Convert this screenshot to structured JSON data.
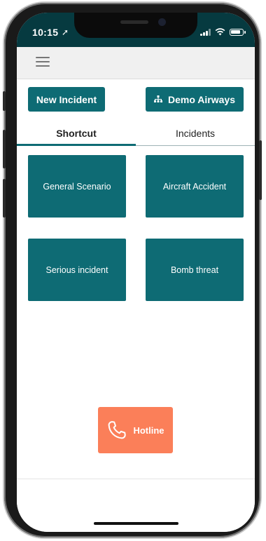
{
  "status_bar": {
    "time": "10:15"
  },
  "header": {
    "menu_icon": "hamburger-icon"
  },
  "actions": {
    "new_incident": "New Incident",
    "organization": "Demo Airways",
    "organization_icon": "org-chart-icon"
  },
  "tabs": [
    {
      "label": "Shortcut",
      "active": true
    },
    {
      "label": "Incidents",
      "active": false
    }
  ],
  "shortcuts": [
    {
      "label": "General Scenario"
    },
    {
      "label": "Aircraft Accident"
    },
    {
      "label": "Serious incident"
    },
    {
      "label": "Bomb threat"
    }
  ],
  "hotline": {
    "label": "Hotline",
    "icon": "phone-icon"
  },
  "colors": {
    "primary": "#0e6b74",
    "status_bar": "#063a40",
    "hotline": "#fb7f59"
  }
}
